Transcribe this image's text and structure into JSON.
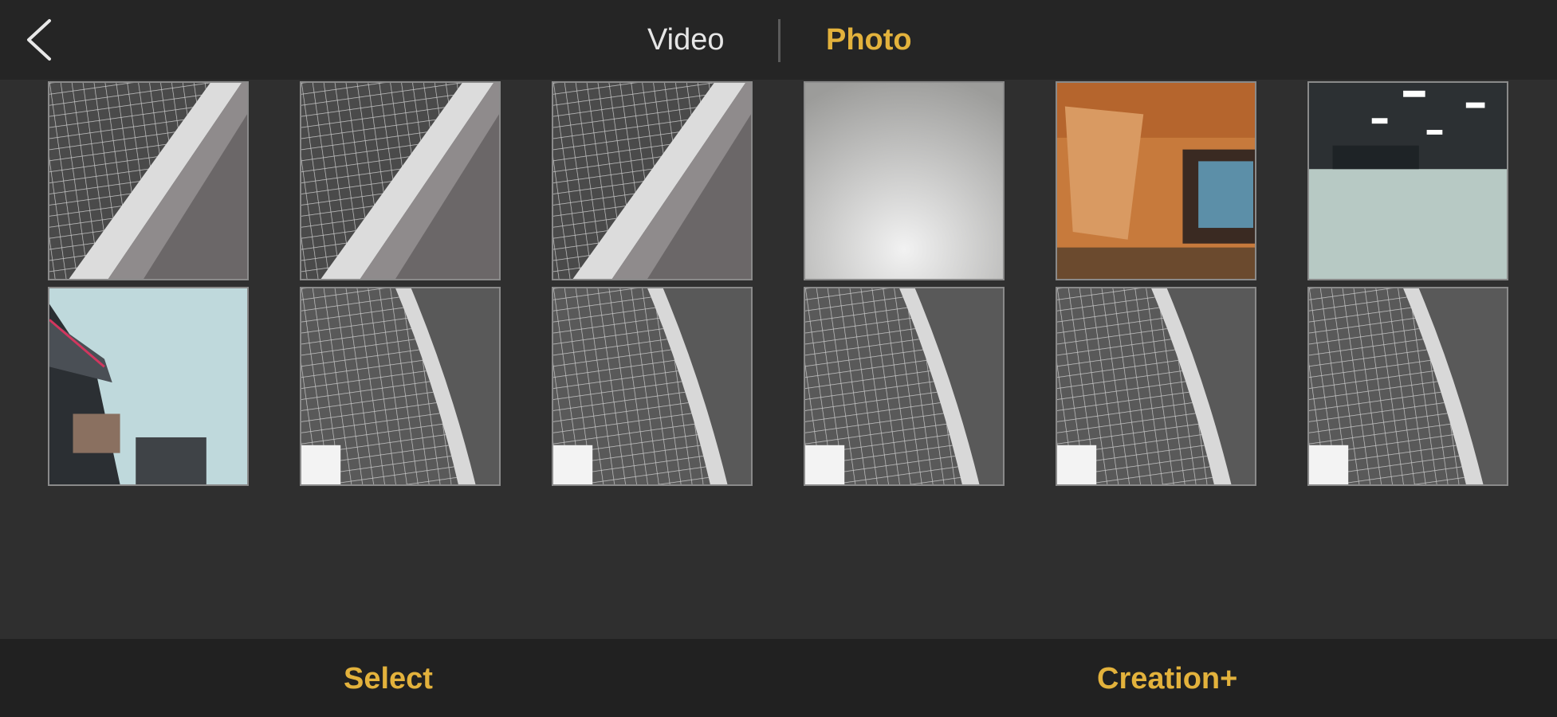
{
  "header": {
    "tabs": [
      {
        "label": "Video",
        "active": false
      },
      {
        "label": "Photo",
        "active": true
      }
    ]
  },
  "gallery": {
    "rows": [
      [
        {
          "kind": "grille-diagonal"
        },
        {
          "kind": "grille-diagonal"
        },
        {
          "kind": "grille-diagonal"
        },
        {
          "kind": "blank-light"
        },
        {
          "kind": "orange-room"
        },
        {
          "kind": "warehouse"
        }
      ],
      [
        {
          "kind": "tilted-interior"
        },
        {
          "kind": "grille-curve"
        },
        {
          "kind": "grille-curve"
        },
        {
          "kind": "grille-curve"
        },
        {
          "kind": "grille-curve"
        },
        {
          "kind": "grille-curve"
        }
      ]
    ]
  },
  "footer": {
    "select_label": "Select",
    "creation_label": "Creation+"
  },
  "colors": {
    "accent": "#e3b23c",
    "background": "#2f2f2f",
    "bar": "#252525"
  }
}
